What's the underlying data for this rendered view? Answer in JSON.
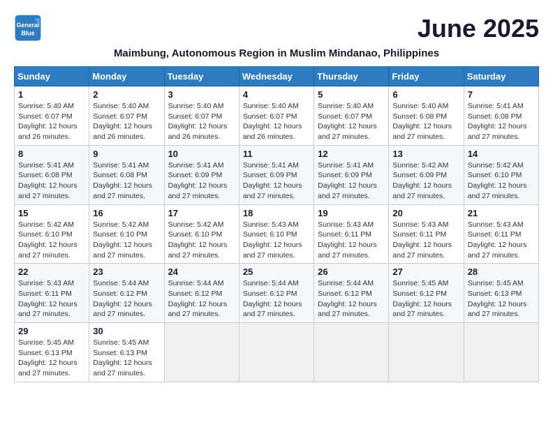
{
  "logo": {
    "line1": "General",
    "line2": "Blue"
  },
  "title": "June 2025",
  "subtitle": "Maimbung, Autonomous Region in Muslim Mindanao, Philippines",
  "days_of_week": [
    "Sunday",
    "Monday",
    "Tuesday",
    "Wednesday",
    "Thursday",
    "Friday",
    "Saturday"
  ],
  "weeks": [
    [
      {
        "day": "1",
        "info": "Sunrise: 5:40 AM\nSunset: 6:07 PM\nDaylight: 12 hours\nand 26 minutes."
      },
      {
        "day": "2",
        "info": "Sunrise: 5:40 AM\nSunset: 6:07 PM\nDaylight: 12 hours\nand 26 minutes."
      },
      {
        "day": "3",
        "info": "Sunrise: 5:40 AM\nSunset: 6:07 PM\nDaylight: 12 hours\nand 26 minutes."
      },
      {
        "day": "4",
        "info": "Sunrise: 5:40 AM\nSunset: 6:07 PM\nDaylight: 12 hours\nand 26 minutes."
      },
      {
        "day": "5",
        "info": "Sunrise: 5:40 AM\nSunset: 6:07 PM\nDaylight: 12 hours\nand 27 minutes."
      },
      {
        "day": "6",
        "info": "Sunrise: 5:40 AM\nSunset: 6:08 PM\nDaylight: 12 hours\nand 27 minutes."
      },
      {
        "day": "7",
        "info": "Sunrise: 5:41 AM\nSunset: 6:08 PM\nDaylight: 12 hours\nand 27 minutes."
      }
    ],
    [
      {
        "day": "8",
        "info": "Sunrise: 5:41 AM\nSunset: 6:08 PM\nDaylight: 12 hours\nand 27 minutes."
      },
      {
        "day": "9",
        "info": "Sunrise: 5:41 AM\nSunset: 6:08 PM\nDaylight: 12 hours\nand 27 minutes."
      },
      {
        "day": "10",
        "info": "Sunrise: 5:41 AM\nSunset: 6:09 PM\nDaylight: 12 hours\nand 27 minutes."
      },
      {
        "day": "11",
        "info": "Sunrise: 5:41 AM\nSunset: 6:09 PM\nDaylight: 12 hours\nand 27 minutes."
      },
      {
        "day": "12",
        "info": "Sunrise: 5:41 AM\nSunset: 6:09 PM\nDaylight: 12 hours\nand 27 minutes."
      },
      {
        "day": "13",
        "info": "Sunrise: 5:42 AM\nSunset: 6:09 PM\nDaylight: 12 hours\nand 27 minutes."
      },
      {
        "day": "14",
        "info": "Sunrise: 5:42 AM\nSunset: 6:10 PM\nDaylight: 12 hours\nand 27 minutes."
      }
    ],
    [
      {
        "day": "15",
        "info": "Sunrise: 5:42 AM\nSunset: 6:10 PM\nDaylight: 12 hours\nand 27 minutes."
      },
      {
        "day": "16",
        "info": "Sunrise: 5:42 AM\nSunset: 6:10 PM\nDaylight: 12 hours\nand 27 minutes."
      },
      {
        "day": "17",
        "info": "Sunrise: 5:42 AM\nSunset: 6:10 PM\nDaylight: 12 hours\nand 27 minutes."
      },
      {
        "day": "18",
        "info": "Sunrise: 5:43 AM\nSunset: 6:10 PM\nDaylight: 12 hours\nand 27 minutes."
      },
      {
        "day": "19",
        "info": "Sunrise: 5:43 AM\nSunset: 6:11 PM\nDaylight: 12 hours\nand 27 minutes."
      },
      {
        "day": "20",
        "info": "Sunrise: 5:43 AM\nSunset: 6:11 PM\nDaylight: 12 hours\nand 27 minutes."
      },
      {
        "day": "21",
        "info": "Sunrise: 5:43 AM\nSunset: 6:11 PM\nDaylight: 12 hours\nand 27 minutes."
      }
    ],
    [
      {
        "day": "22",
        "info": "Sunrise: 5:43 AM\nSunset: 6:11 PM\nDaylight: 12 hours\nand 27 minutes."
      },
      {
        "day": "23",
        "info": "Sunrise: 5:44 AM\nSunset: 6:12 PM\nDaylight: 12 hours\nand 27 minutes."
      },
      {
        "day": "24",
        "info": "Sunrise: 5:44 AM\nSunset: 6:12 PM\nDaylight: 12 hours\nand 27 minutes."
      },
      {
        "day": "25",
        "info": "Sunrise: 5:44 AM\nSunset: 6:12 PM\nDaylight: 12 hours\nand 27 minutes."
      },
      {
        "day": "26",
        "info": "Sunrise: 5:44 AM\nSunset: 6:12 PM\nDaylight: 12 hours\nand 27 minutes."
      },
      {
        "day": "27",
        "info": "Sunrise: 5:45 AM\nSunset: 6:12 PM\nDaylight: 12 hours\nand 27 minutes."
      },
      {
        "day": "28",
        "info": "Sunrise: 5:45 AM\nSunset: 6:13 PM\nDaylight: 12 hours\nand 27 minutes."
      }
    ],
    [
      {
        "day": "29",
        "info": "Sunrise: 5:45 AM\nSunset: 6:13 PM\nDaylight: 12 hours\nand 27 minutes."
      },
      {
        "day": "30",
        "info": "Sunrise: 5:45 AM\nSunset: 6:13 PM\nDaylight: 12 hours\nand 27 minutes."
      },
      {
        "day": "",
        "info": ""
      },
      {
        "day": "",
        "info": ""
      },
      {
        "day": "",
        "info": ""
      },
      {
        "day": "",
        "info": ""
      },
      {
        "day": "",
        "info": ""
      }
    ]
  ]
}
